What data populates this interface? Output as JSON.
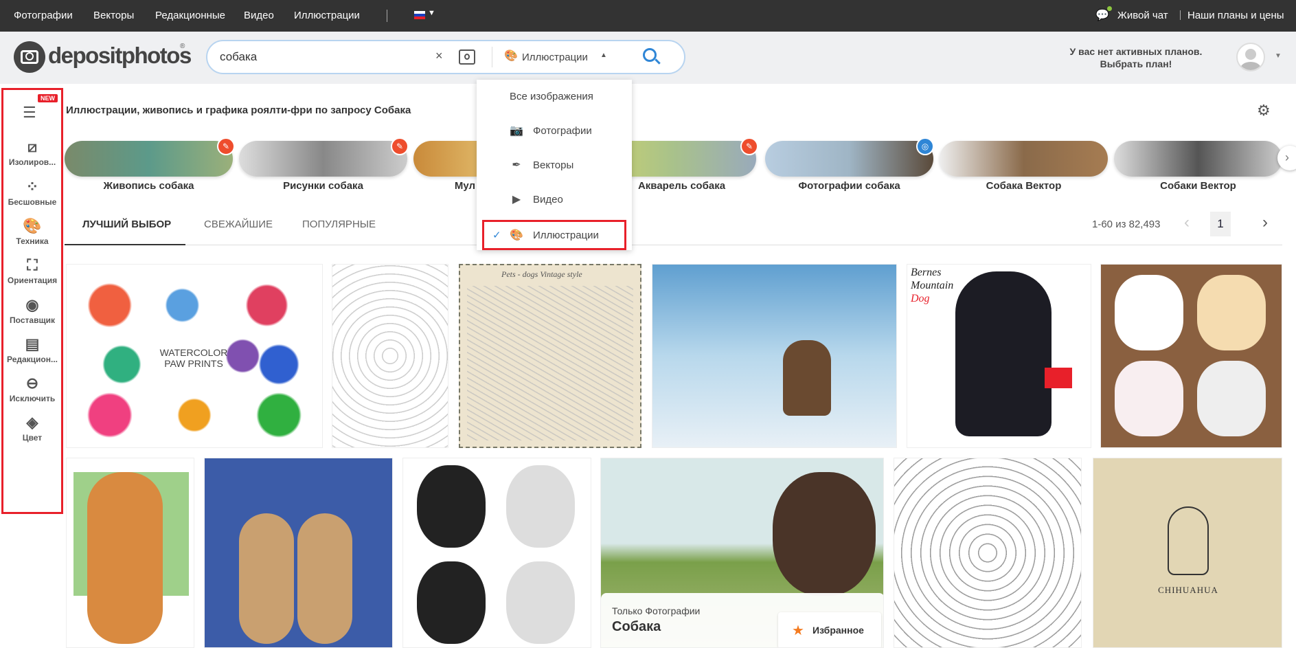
{
  "topbar": {
    "nav": [
      "Фотографии",
      "Векторы",
      "Редакционные",
      "Видео",
      "Иллюстрации"
    ],
    "live_chat": "Живой чат",
    "plans": "Наши планы и цены"
  },
  "header": {
    "logo": "depositphotos",
    "search_value": "собака",
    "search_type": "Иллюстрации",
    "plan_line1": "У вас нет активных планов.",
    "plan_line2": "Выбрать план!"
  },
  "dropdown": {
    "items": [
      "Все изображения",
      "Фотографии",
      "Векторы",
      "Видео",
      "Иллюстрации"
    ],
    "selected": "Иллюстрации"
  },
  "sidebar": {
    "new_badge": "NEW",
    "items": [
      "Изолиров...",
      "Бесшовные",
      "Техника",
      "Ориентация",
      "Поставщик",
      "Редакцион...",
      "Исключить",
      "Цвет"
    ]
  },
  "main": {
    "title": "Иллюстрации, живопись и графика роялти-фри по запросу Собака",
    "chips": [
      "Живопись собака",
      "Рисунки собака",
      "Мул",
      "Акварель собака",
      "Фотографии собака",
      "Собака Вектор",
      "Собаки Вектор"
    ],
    "tabs": [
      "ЛУЧШИЙ ВЫБОР",
      "СВЕЖАЙШИЕ",
      "ПОПУЛЯРНЫЕ"
    ],
    "results": "1-60 из 82,493",
    "page": "1",
    "img_texts": {
      "paw": "WATERCOLOR PAW PRINTS",
      "vintage": "Pets - dogs Vintage style",
      "bernes1": "Bernes",
      "bernes2": "Mountain",
      "bernes3": "Dog",
      "chihuahua": "CHIHUAHUA"
    },
    "promo": {
      "sub": "Только Фотографии",
      "title": "Собака",
      "fav": "Избранное"
    }
  },
  "colors": {
    "accent": "#2f86d6",
    "red": "#e8202a",
    "orange": "#f47b20",
    "topbar": "#333333"
  }
}
